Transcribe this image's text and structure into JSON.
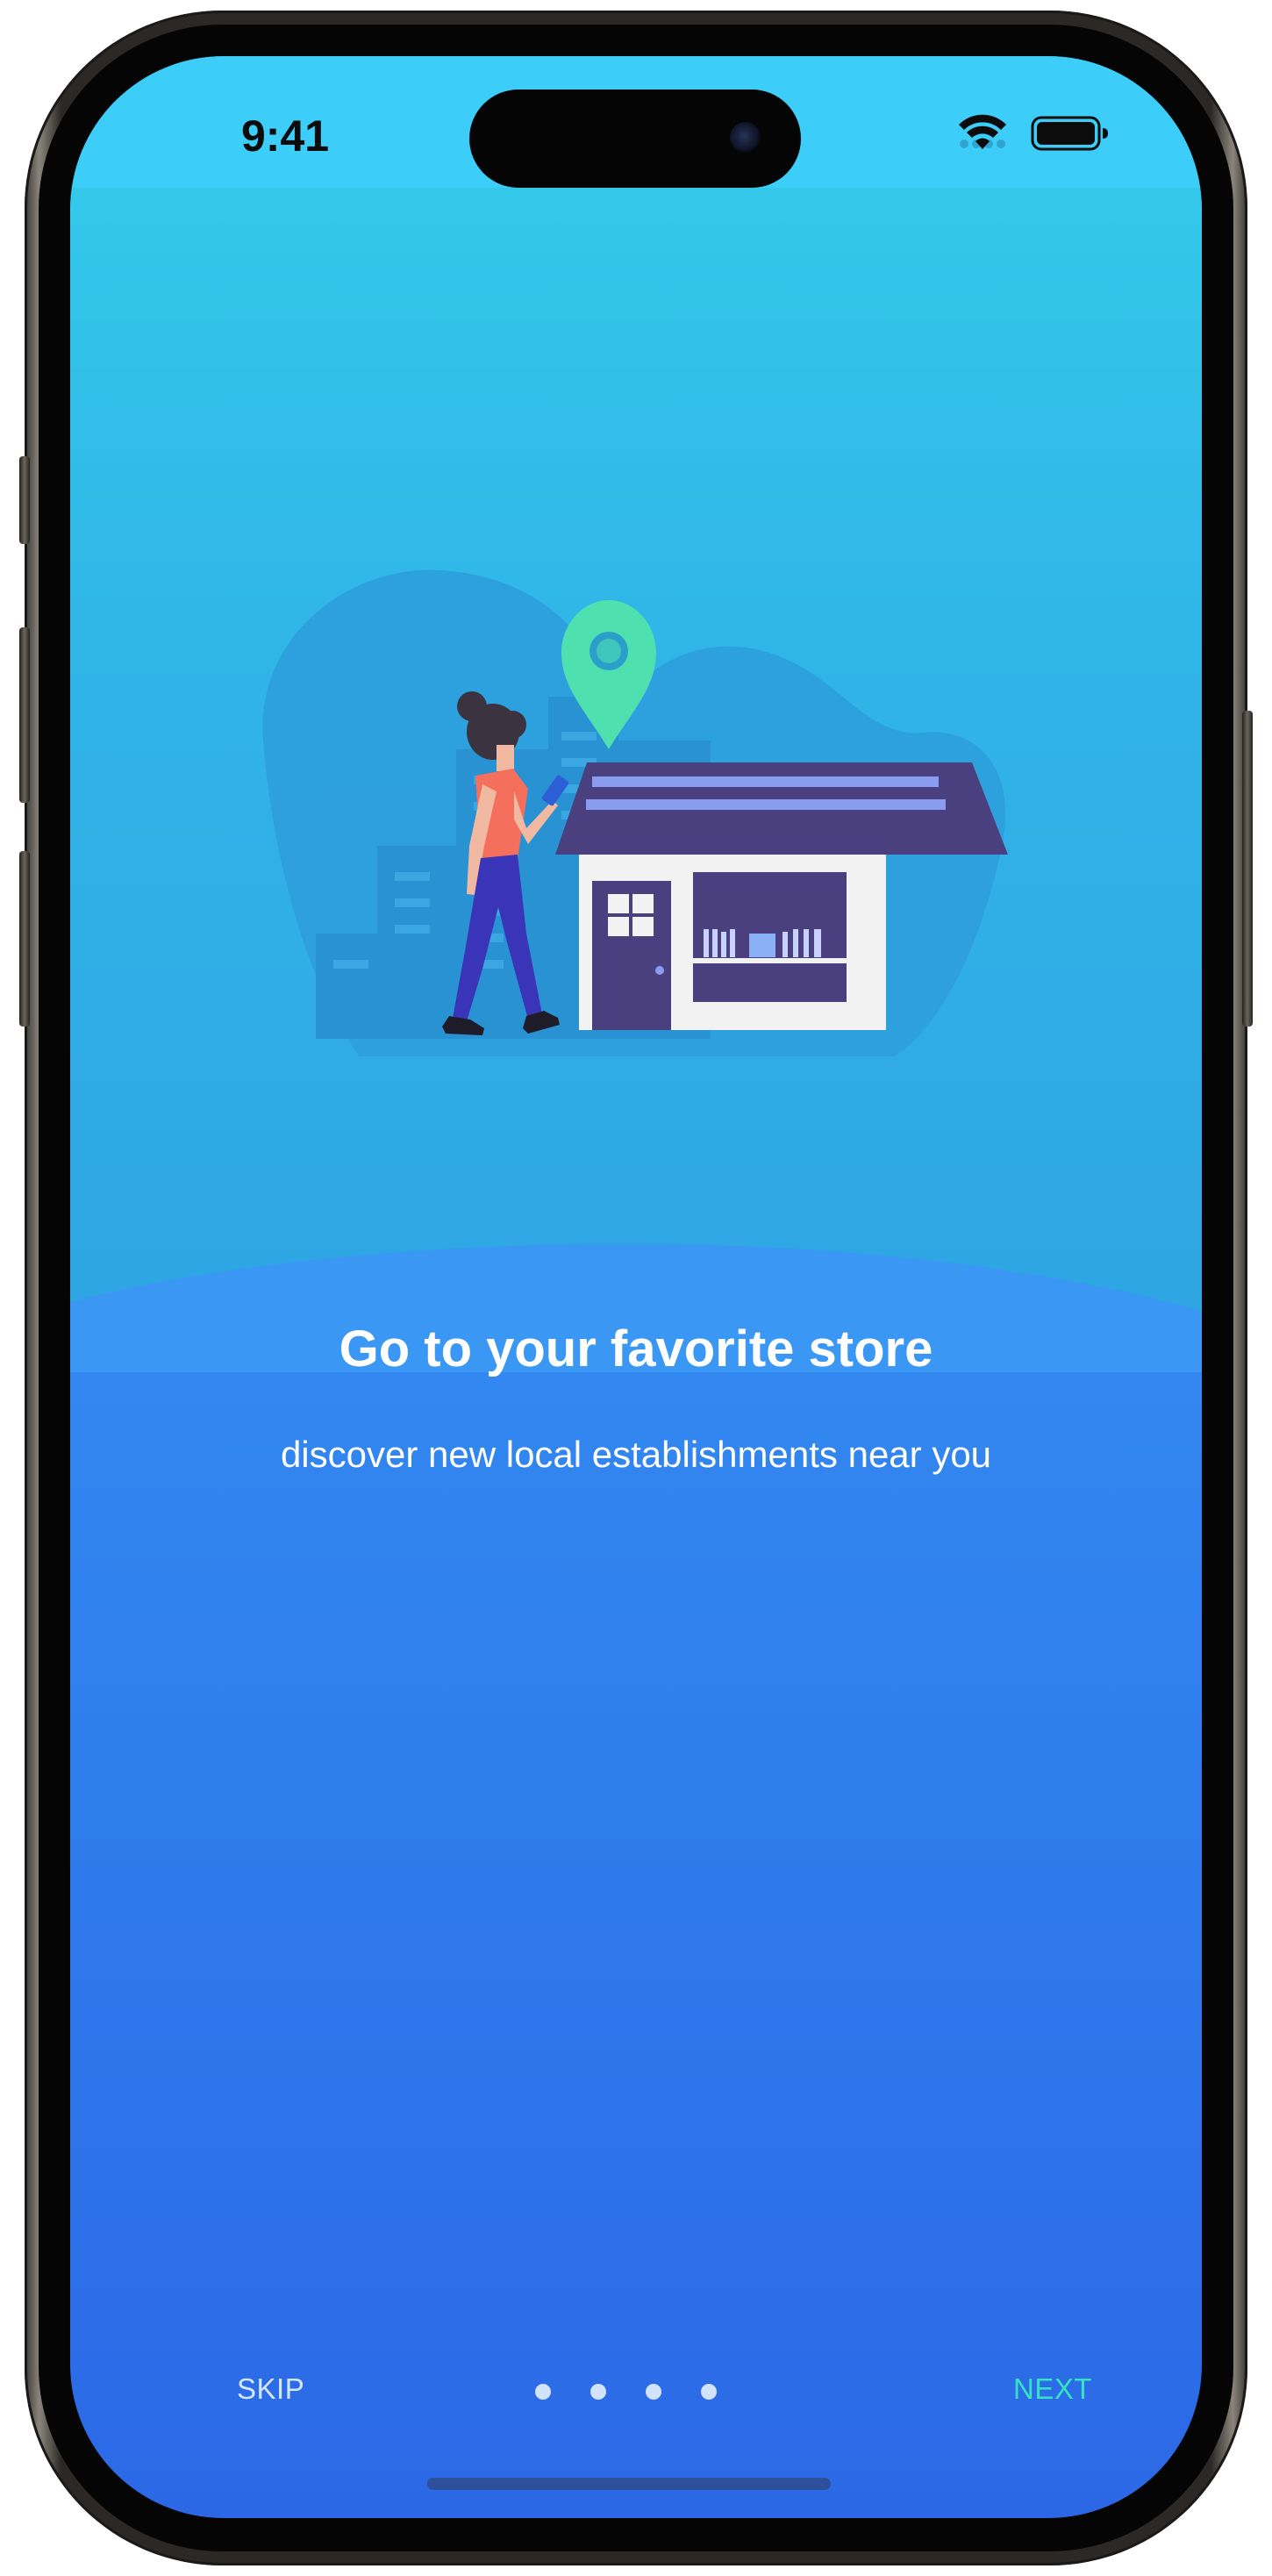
{
  "status_bar": {
    "time": "9:41",
    "icons": [
      "signal-icon",
      "wifi-icon",
      "battery-icon"
    ]
  },
  "onboarding": {
    "illustration": "person-walking-to-store-illustration",
    "title": "Go to your favorite store",
    "subtitle": "discover new local establishments near you"
  },
  "footer": {
    "skip_label": "SKIP",
    "next_label": "NEXT",
    "page_count": 4,
    "current_page": 1
  },
  "colors": {
    "accent_next": "#35e2c2",
    "pin": "#4fe0b0",
    "shirt": "#f4705c",
    "pants": "#3a34b8",
    "house_roof": "#4a4080",
    "house_wall": "#f2f2f2"
  }
}
